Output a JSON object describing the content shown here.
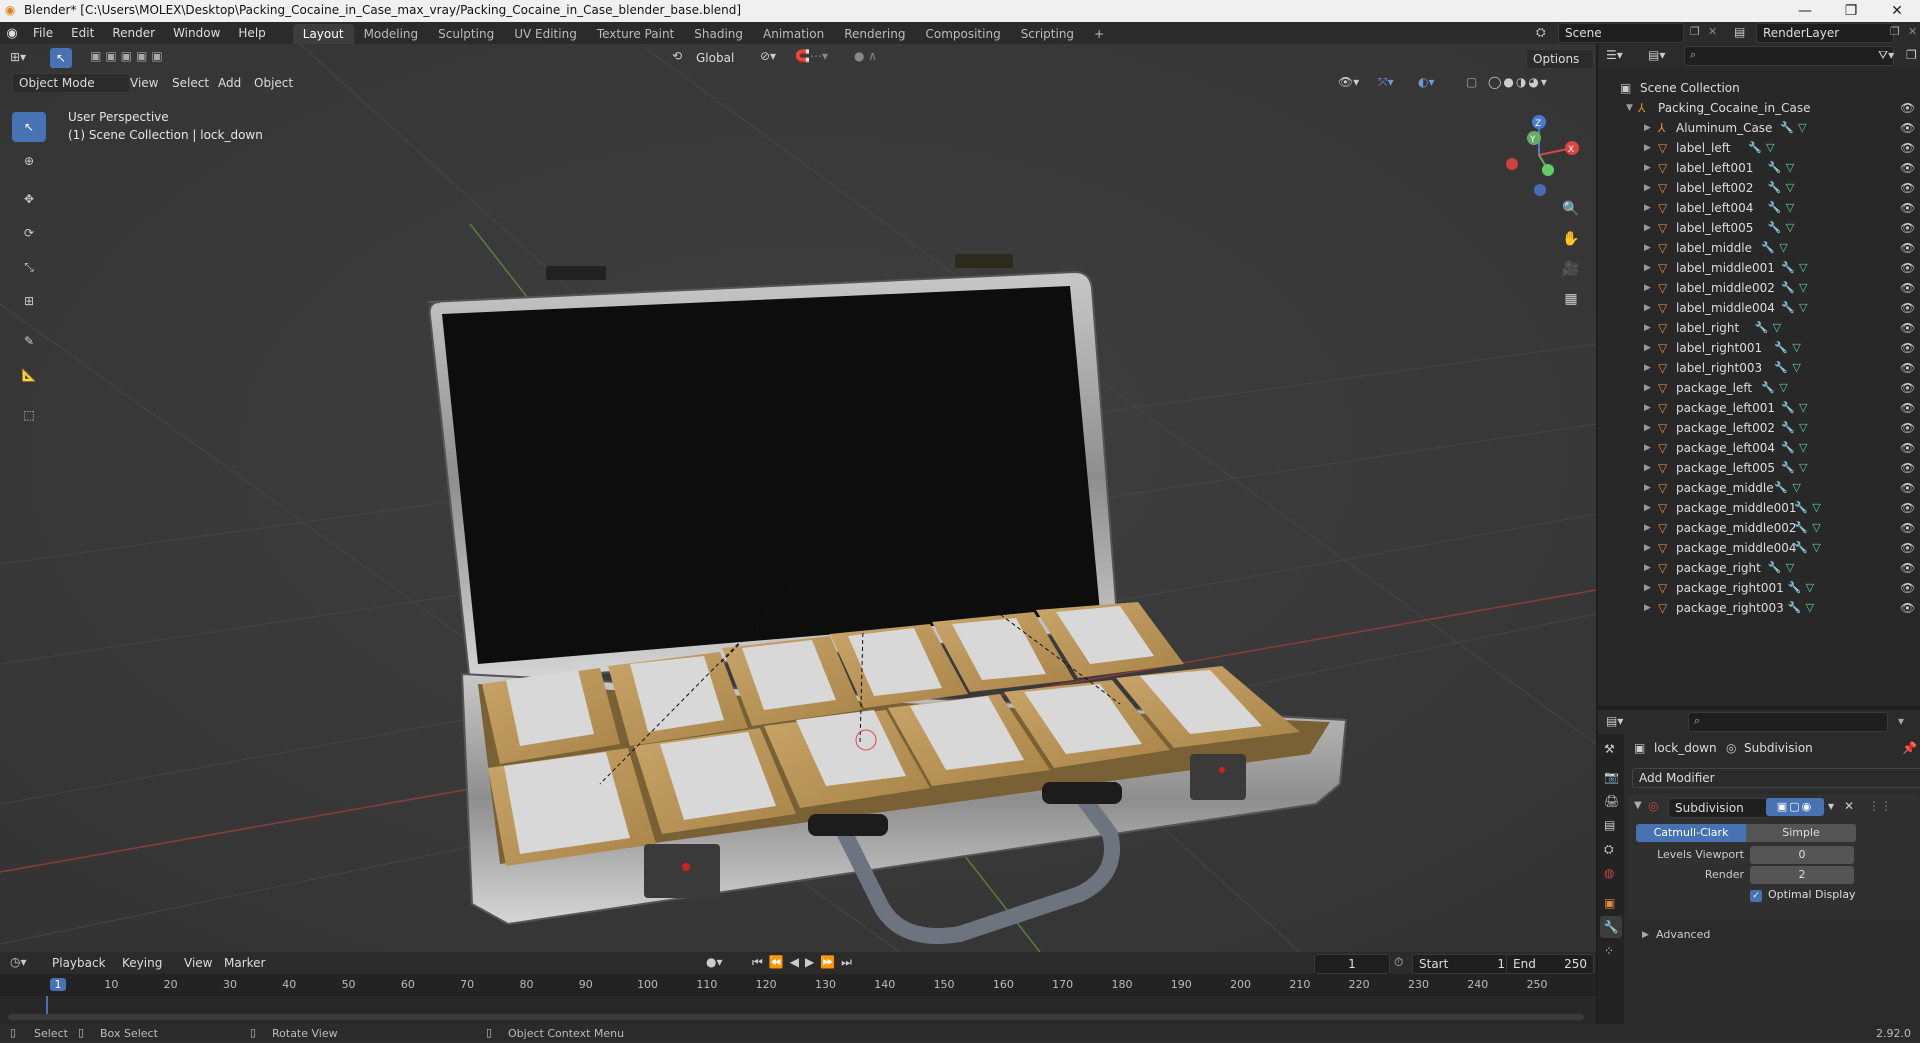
{
  "window": {
    "title": "Blender* [C:\\Users\\MOLEX\\Desktop\\Packing_Cocaine_in_Case_max_vray/Packing_Cocaine_in_Case_blender_base.blend]",
    "minimize": "—",
    "maximize": "❐",
    "close": "✕"
  },
  "menu": {
    "items": [
      "File",
      "Edit",
      "Render",
      "Window",
      "Help"
    ]
  },
  "workspaces": [
    "Layout",
    "Modeling",
    "Sculpting",
    "UV Editing",
    "Texture Paint",
    "Shading",
    "Animation",
    "Rendering",
    "Compositing",
    "Scripting"
  ],
  "workspace_add": "+",
  "scene": {
    "name": "Scene",
    "view_layer": "RenderLayer"
  },
  "viewport": {
    "mode": "Object Mode",
    "menus": [
      "View",
      "Select",
      "Add",
      "Object"
    ],
    "transform_orientation": "Global",
    "options": "Options",
    "info_line1": "User Perspective",
    "info_line2": "(1) Scene Collection | lock_down",
    "gizmo": {
      "x": "X",
      "y": "Y",
      "z": "Z"
    }
  },
  "outliner": {
    "search_placeholder": "",
    "root": "Scene Collection",
    "collection": "Packing_Cocaine_in_Case",
    "objects": [
      "Aluminum_Case",
      "label_left",
      "label_left001",
      "label_left002",
      "label_left004",
      "label_left005",
      "label_middle",
      "label_middle001",
      "label_middle002",
      "label_middle004",
      "label_right",
      "label_right001",
      "label_right003",
      "package_left",
      "package_left001",
      "package_left002",
      "package_left004",
      "package_left005",
      "package_middle",
      "package_middle001",
      "package_middle002",
      "package_middle004",
      "package_right",
      "package_right001",
      "package_right003"
    ]
  },
  "properties": {
    "object": "lock_down",
    "modifier_tab": "Subdivision",
    "add_modifier": "Add Modifier",
    "modifier_name": "Subdivision",
    "mode_a": "Catmull-Clark",
    "mode_b": "Simple",
    "levels_viewport_label": "Levels Viewport",
    "levels_viewport_value": "0",
    "render_label": "Render",
    "render_value": "2",
    "optimal_display": "Optimal Display",
    "advanced": "Advanced"
  },
  "timeline": {
    "menus": [
      "Playback",
      "Keying",
      "View",
      "Marker"
    ],
    "current_frame": "1",
    "start_label": "Start",
    "start_value": "1",
    "end_label": "End",
    "end_value": "250",
    "ruler": [
      "1",
      "10",
      "20",
      "30",
      "40",
      "50",
      "60",
      "70",
      "80",
      "90",
      "100",
      "110",
      "120",
      "130",
      "140",
      "150",
      "160",
      "170",
      "180",
      "190",
      "200",
      "210",
      "220",
      "230",
      "240",
      "250"
    ]
  },
  "status": {
    "select": "Select",
    "box_select": "Box Select",
    "rotate_view": "Rotate View",
    "context_menu": "Object Context Menu",
    "version": "2.92.0"
  },
  "colors": {
    "accent": "#4772b3",
    "mesh_icon": "#e08b3b",
    "modifier_icon": "#6a9bd8",
    "data_icon": "#5fd4a0"
  }
}
